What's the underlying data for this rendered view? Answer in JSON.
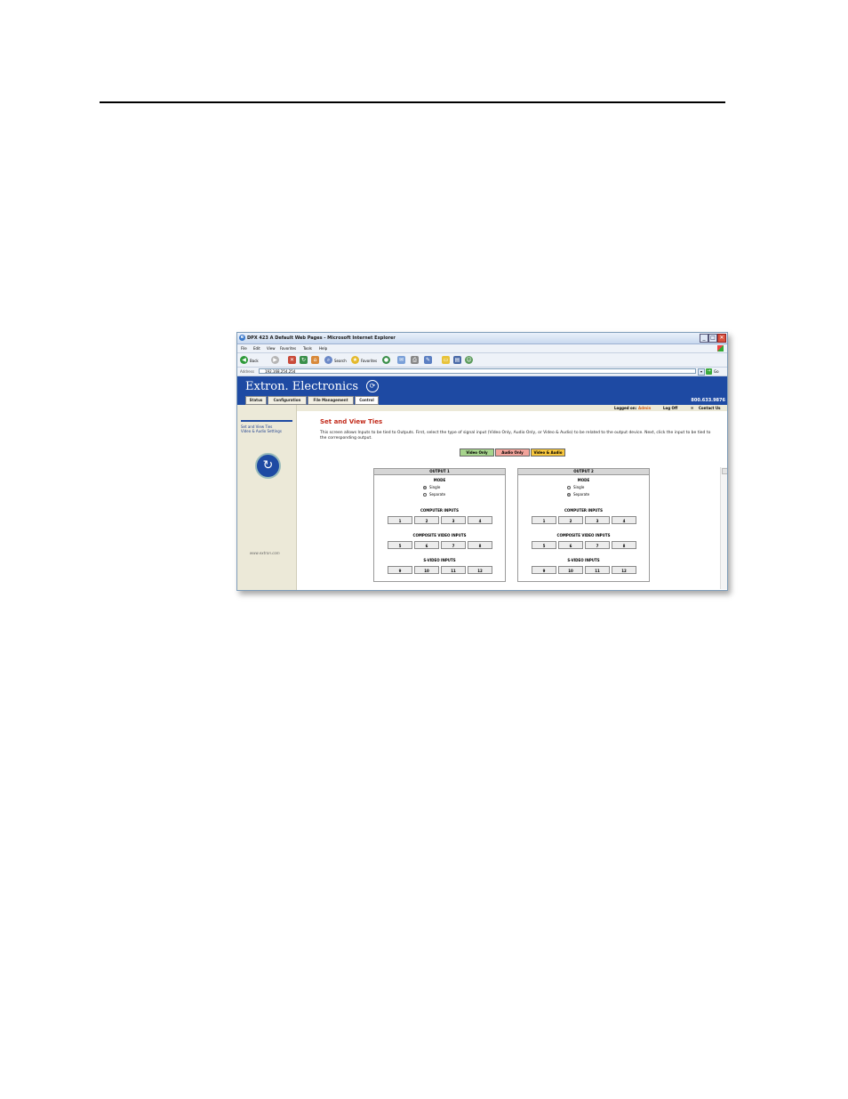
{
  "window": {
    "title": "DPX 423 A Default Web Pages - Microsoft Internet Explorer",
    "min": "_",
    "max": "□",
    "close": "✕"
  },
  "menu": [
    "File",
    "Edit",
    "View",
    "Favorites",
    "Tools",
    "Help"
  ],
  "toolbar": {
    "back": "Back",
    "search": "Search",
    "favorites": "Favorites"
  },
  "address": {
    "label": "Address",
    "value": "192.168.254.254",
    "go": "Go"
  },
  "banner": {
    "brand": "Extron. Electronics",
    "phone": "800.633.9876",
    "tabs": [
      "Status",
      "Configuration",
      "File Management",
      "Control"
    ],
    "logged_label": "Logged on:",
    "user": "Admin",
    "logoff": "Log Off",
    "contact": "Contact Us"
  },
  "sidebar": {
    "items": [
      "Set and View Ties",
      "Video & Audio Settings"
    ],
    "url": "www.extron.com"
  },
  "main": {
    "heading": "Set and View Ties",
    "description": "This screen allows Inputs to be tied to Outputs. First, select the type of signal input (Video Only, Audio Only, or Video & Audio) to be related to the output device. Next, click the input to be tied to the corresponding output.",
    "signals": [
      {
        "label": "Video Only",
        "color": "#a6d48c"
      },
      {
        "label": "Audio Only",
        "color": "#f2a39a"
      },
      {
        "label": "Video & Audio",
        "color": "#f7c63c"
      }
    ]
  },
  "outputs": [
    {
      "title": "OUTPUT 1",
      "mode_label": "MODE",
      "modes": [
        "Single",
        "Separate"
      ],
      "selected_mode": "Single",
      "groups": [
        {
          "label": "COMPUTER INPUTS",
          "buttons": [
            "1",
            "2",
            "3",
            "4"
          ]
        },
        {
          "label": "COMPOSITE VIDEO INPUTS",
          "buttons": [
            "5",
            "6",
            "7",
            "8"
          ]
        },
        {
          "label": "S-VIDEO INPUTS",
          "buttons": [
            "9",
            "10",
            "11",
            "12"
          ]
        }
      ]
    },
    {
      "title": "OUTPUT 2",
      "mode_label": "MODE",
      "modes": [
        "Single",
        "Separate"
      ],
      "selected_mode": "Separate",
      "groups": [
        {
          "label": "COMPUTER INPUTS",
          "buttons": [
            "1",
            "2",
            "3",
            "4"
          ]
        },
        {
          "label": "COMPOSITE VIDEO INPUTS",
          "buttons": [
            "5",
            "6",
            "7",
            "8"
          ]
        },
        {
          "label": "S-VIDEO INPUTS",
          "buttons": [
            "9",
            "10",
            "11",
            "12"
          ]
        }
      ]
    }
  ]
}
